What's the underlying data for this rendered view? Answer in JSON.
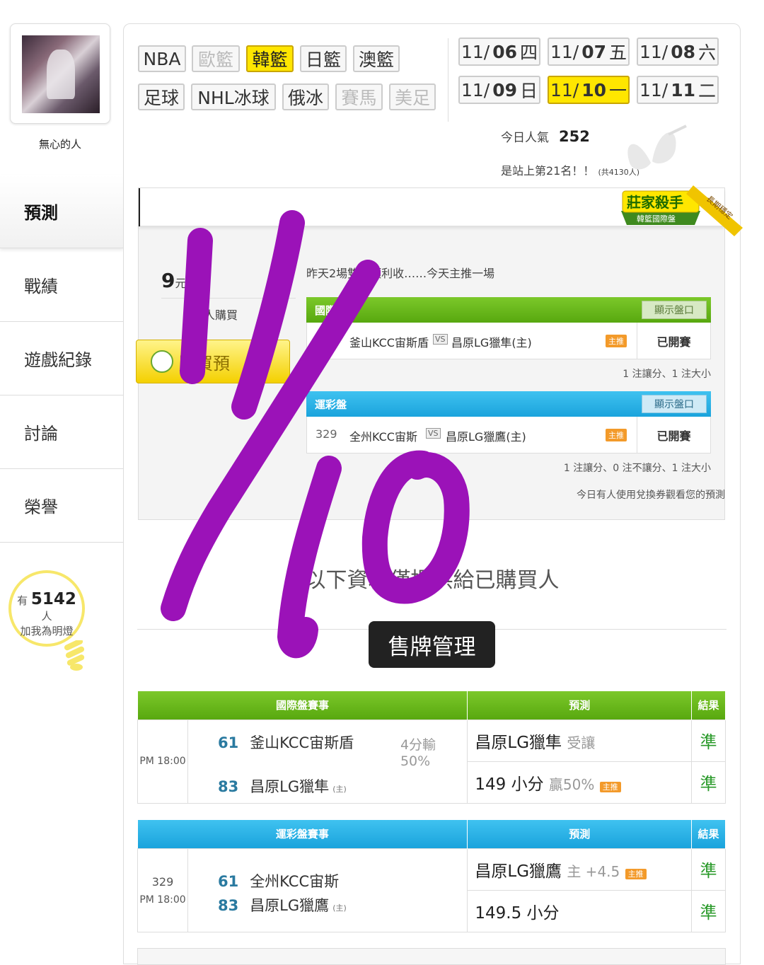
{
  "user": {
    "name": "無心的人"
  },
  "sidebar": {
    "items": [
      "預測",
      "戰績",
      "遊戲紀錄",
      "討論",
      "榮譽"
    ],
    "active": "預測"
  },
  "fans": {
    "prefix": "有",
    "count": "5142",
    "suffix": "人",
    "label": "加我為明燈"
  },
  "leagues": {
    "row1": [
      {
        "label": "NBA",
        "state": "normal"
      },
      {
        "label": "歐籃",
        "state": "dim"
      },
      {
        "label": "韓籃",
        "state": "active"
      },
      {
        "label": "日籃",
        "state": "normal"
      },
      {
        "label": "澳籃",
        "state": "normal"
      }
    ],
    "row2": [
      {
        "label": "足球",
        "state": "normal"
      },
      {
        "label": "NHL冰球",
        "state": "normal"
      },
      {
        "label": "俄冰",
        "state": "normal"
      },
      {
        "label": "賽馬",
        "state": "dim"
      },
      {
        "label": "美足",
        "state": "dim"
      }
    ]
  },
  "dates": {
    "row1": [
      {
        "md": "11/",
        "d": "06",
        "wd": "四"
      },
      {
        "md": "11/",
        "d": "07",
        "wd": "五"
      },
      {
        "md": "11/",
        "d": "08",
        "wd": "六"
      }
    ],
    "row2": [
      {
        "md": "11/",
        "d": "09",
        "wd": "日"
      },
      {
        "md": "11/",
        "d": "10",
        "wd": "一",
        "active": true
      },
      {
        "md": "11/",
        "d": "11",
        "wd": "二"
      }
    ]
  },
  "stats": {
    "popular_label": "今日人氣",
    "popular_value": "252",
    "rank_text": "是站上第21名！！",
    "rank_total": "(共4130人)"
  },
  "badge": {
    "title": "莊家殺手",
    "sub": "韓籃國際盤",
    "ribbon": "長期穩定"
  },
  "purchase": {
    "price_prefix": "9",
    "price_label": "元噓幣",
    "buyers_label": "人購買",
    "button": "購買預",
    "intro": "昨天2場雙推順利收……今天主推一場",
    "intl": {
      "title": "國際盤",
      "show_btn": "顯示盤口",
      "home": "釜山KCC宙斯盾",
      "vs": "VS",
      "away": "昌原LG獵隼(主)",
      "tag": "主推",
      "status": "已開賽",
      "note": "1 注讓分、1 注大小"
    },
    "lottery": {
      "title": "運彩盤",
      "show_btn": "顯示盤口",
      "num": "329",
      "home": "全州KCC宙斯",
      "vs": "VS",
      "away": "昌原LG獵鷹(主)",
      "tag": "主推",
      "status": "已開賽",
      "note": "1 注讓分、0 注不讓分、1 注大小"
    },
    "viewed_note": "今日有人使用兌換券觀看您的預測"
  },
  "only_buyers": "以下資料僅提供給已購買人",
  "tooltip": "售牌管理",
  "results": {
    "intl": {
      "headers": [
        "國際盤賽事",
        "預測",
        "結果"
      ],
      "time": "PM 18:00",
      "teams": [
        {
          "score": "61",
          "name": "釜山KCC宙斯盾",
          "home": ""
        },
        {
          "score": "83",
          "name": "昌原LG獵隼",
          "home": "(主)"
        }
      ],
      "line": "4分輸 50%",
      "preds": [
        {
          "text": "昌原LG獵隼",
          "sub": "受讓",
          "tag": "",
          "result": "準"
        },
        {
          "text": "149 小分",
          "sub": "贏50%",
          "tag": "主推",
          "result": "準"
        }
      ]
    },
    "lottery": {
      "headers": [
        "運彩盤賽事",
        "預測",
        "結果"
      ],
      "num": "329",
      "time": "PM 18:00",
      "teams": [
        {
          "score": "61",
          "name": "全州KCC宙斯",
          "home": ""
        },
        {
          "score": "83",
          "name": "昌原LG獵鷹",
          "home": "(主)"
        }
      ],
      "preds": [
        {
          "text": "昌原LG獵鷹",
          "sub": "主 +4.5",
          "tag": "主推",
          "result": "準"
        },
        {
          "text": "149.5 小分",
          "sub": "",
          "tag": "",
          "result": "準"
        }
      ]
    }
  },
  "colors": {
    "accent_yellow": "#ffe600",
    "green": "#6abc1e",
    "blue": "#2ab2e8",
    "ink": "#9b12b8"
  }
}
